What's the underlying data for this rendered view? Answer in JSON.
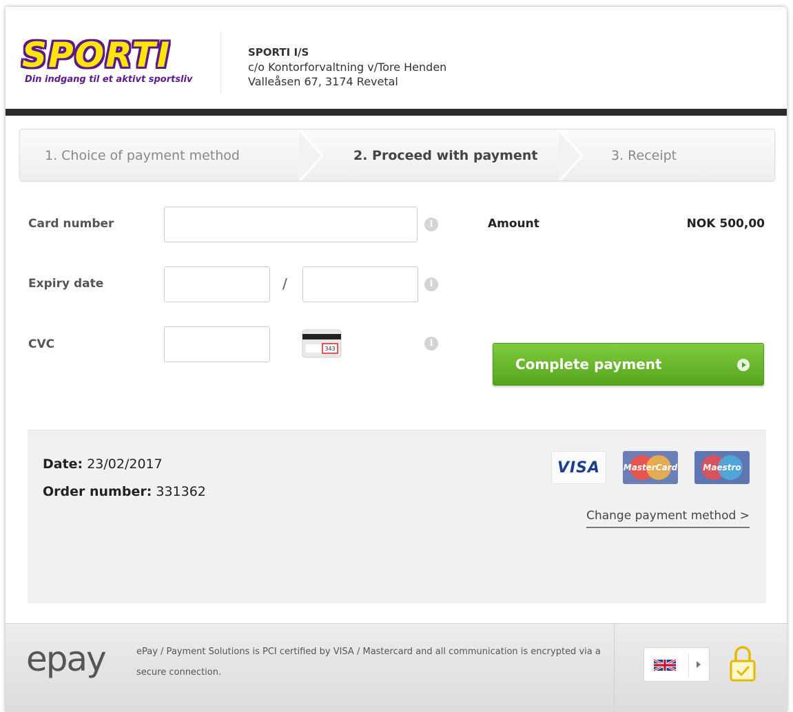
{
  "header": {
    "logo_text": "SPORTI",
    "logo_tagline": "Din indgang til et aktivt sportsliv",
    "merchant_name": "SPORTI I/S",
    "merchant_address_1": "c/o Kontorforvaltning v/Tore Henden",
    "merchant_address_2": "Valleåsen 67, 3174 Revetal"
  },
  "steps": [
    {
      "label": "1. Choice of payment method",
      "active": false
    },
    {
      "label": "2. Proceed with payment",
      "active": true
    },
    {
      "label": "3. Receipt",
      "active": false
    }
  ],
  "form": {
    "card_number_label": "Card number",
    "card_number_value": "",
    "expiry_label": "Expiry date",
    "expiry_month_value": "",
    "expiry_year_value": "",
    "expiry_separator": "/",
    "cvc_label": "CVC",
    "cvc_value": "",
    "cvc_sample": "343",
    "info_glyph": "i"
  },
  "amount": {
    "label": "Amount",
    "value": "NOK 500,00"
  },
  "pay_button": {
    "label": "Complete payment"
  },
  "summary": {
    "date_label": "Date:",
    "date_value": "23/02/2017",
    "order_label": "Order number:",
    "order_value": "331362",
    "card_logos": [
      "VISA",
      "MasterCard",
      "Maestro"
    ],
    "change_link": "Change payment method >"
  },
  "footer": {
    "logo_text": "epay",
    "text": "ePay / Payment Solutions is PCI certified by VISA / Mastercard and all communication is encrypted via a secure connection."
  },
  "colors": {
    "brand_purple": "#5a1a8c",
    "brand_yellow": "#ffe600",
    "pay_green": "#6cbd2f",
    "lock_yellow": "#e6b800"
  },
  "icons": {
    "info": "info-icon",
    "cvc": "cvc-card-icon",
    "language": "uk-flag-icon",
    "secure": "padlock-check-icon"
  }
}
